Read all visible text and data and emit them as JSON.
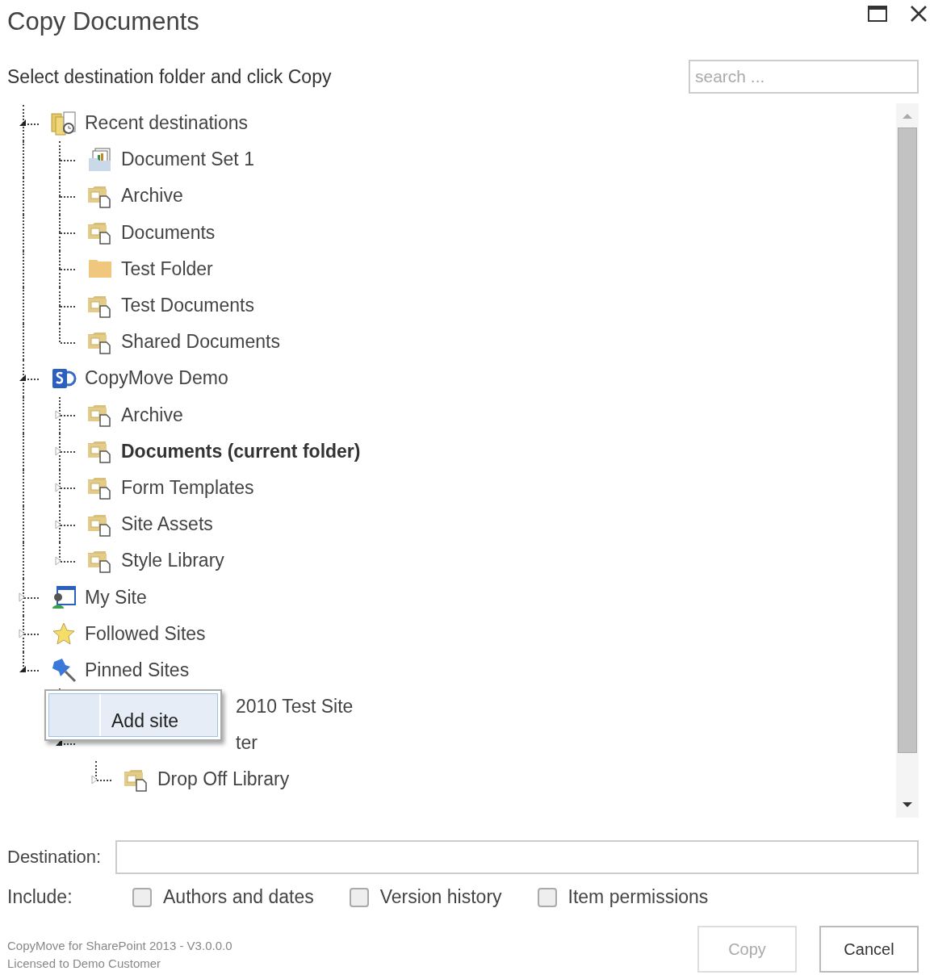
{
  "window": {
    "title": "Copy Documents"
  },
  "instruction": "Select destination folder and click Copy",
  "search": {
    "placeholder": "search ..."
  },
  "tree": [
    {
      "label": "Recent destinations",
      "kind": "recent",
      "expanded": true,
      "current": false,
      "children": [
        {
          "label": "Document Set 1",
          "kind": "docset",
          "current": false
        },
        {
          "label": "Archive",
          "kind": "library",
          "current": false
        },
        {
          "label": "Documents",
          "kind": "library",
          "current": false
        },
        {
          "label": "Test Folder",
          "kind": "folder",
          "current": false
        },
        {
          "label": "Test Documents",
          "kind": "library",
          "current": false
        },
        {
          "label": "Shared Documents",
          "kind": "library",
          "current": false
        }
      ]
    },
    {
      "label": "CopyMove Demo",
      "kind": "site",
      "expanded": true,
      "current": false,
      "children": [
        {
          "label": "Archive",
          "kind": "library",
          "expanded": false,
          "current": false
        },
        {
          "label": "Documents (current folder)",
          "kind": "library",
          "expanded": false,
          "current": true
        },
        {
          "label": "Form Templates",
          "kind": "library",
          "expanded": false,
          "current": false
        },
        {
          "label": "Site Assets",
          "kind": "library",
          "expanded": false,
          "current": false
        },
        {
          "label": "Style Library",
          "kind": "library",
          "expanded": false,
          "current": false
        }
      ]
    },
    {
      "label": "My Site",
      "kind": "mysite",
      "expanded": false,
      "current": false
    },
    {
      "label": "Followed Sites",
      "kind": "star",
      "expanded": false,
      "current": false
    },
    {
      "label": "Pinned Sites",
      "kind": "pin",
      "expanded": true,
      "current": false,
      "children": [
        {
          "label": "2010 Test Site",
          "covered": true,
          "current": false
        },
        {
          "label": "ter",
          "covered": true,
          "expanded": true,
          "current": false,
          "children": [
            {
              "label": "Drop Off Library",
              "kind": "library",
              "expanded": false,
              "current": false
            }
          ]
        }
      ]
    }
  ],
  "context_menu": {
    "items": [
      "Add site"
    ]
  },
  "destination": {
    "label": "Destination:"
  },
  "include": {
    "label": "Include:",
    "options": [
      {
        "label": "Authors and dates",
        "checked": false
      },
      {
        "label": "Version history",
        "checked": false
      },
      {
        "label": "Item permissions",
        "checked": false
      }
    ]
  },
  "footer": {
    "product": "CopyMove for SharePoint 2013 - V3.0.0.0",
    "license": "Licensed to Demo Customer"
  },
  "buttons": [
    {
      "label": "Copy",
      "disabled": true
    },
    {
      "label": "Cancel",
      "disabled": false
    }
  ]
}
